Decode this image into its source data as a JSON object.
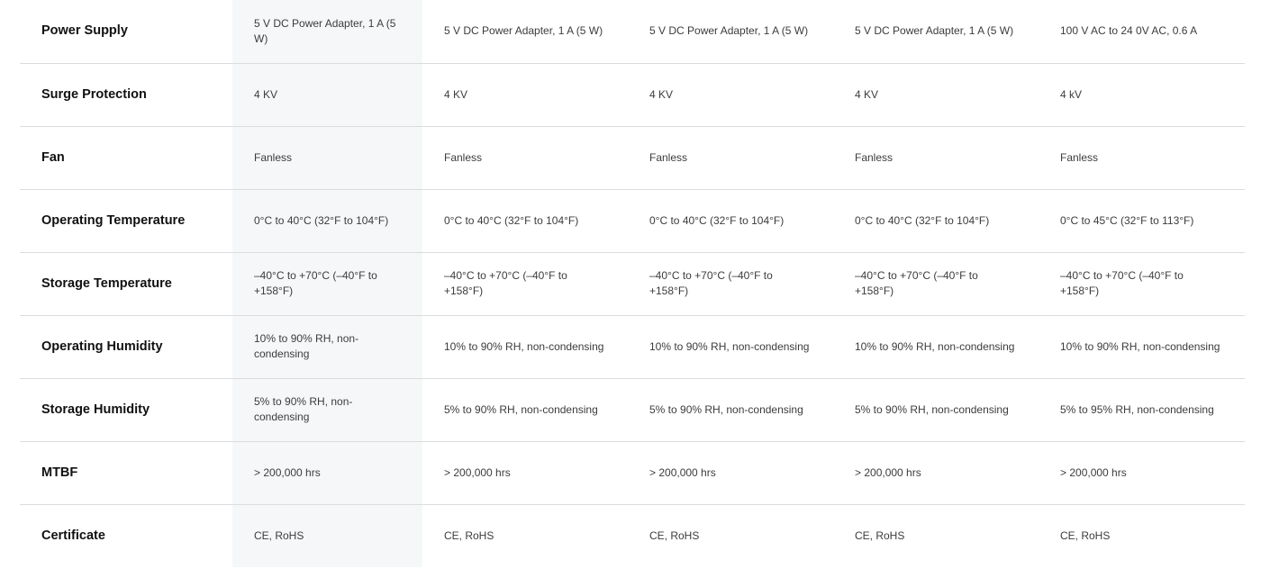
{
  "rows": [
    {
      "label": "Power Supply",
      "values": [
        "5 V DC Power Adapter, 1 A (5 W)",
        "5 V DC Power Adapter, 1 A (5 W)",
        "5 V DC Power Adapter, 1 A (5 W)",
        "5 V DC Power Adapter, 1 A (5 W)",
        "100 V AC to 24 0V AC, 0.6 A"
      ]
    },
    {
      "label": "Surge Protection",
      "values": [
        "4 KV",
        "4 KV",
        "4 KV",
        "4 KV",
        "4 kV"
      ]
    },
    {
      "label": "Fan",
      "values": [
        "Fanless",
        "Fanless",
        "Fanless",
        "Fanless",
        "Fanless"
      ]
    },
    {
      "label": "Operating Temperature",
      "values": [
        "0°C to 40°C (32°F to 104°F)",
        "0°C to 40°C (32°F to 104°F)",
        "0°C to 40°C (32°F to 104°F)",
        "0°C to 40°C (32°F to 104°F)",
        "0°C to 45°C (32°F to 113°F)"
      ]
    },
    {
      "label": "Storage Temperature",
      "values": [
        "–40°C to +70°C (–40°F to +158°F)",
        "–40°C to +70°C (–40°F to +158°F)",
        "–40°C to +70°C (–40°F to +158°F)",
        "–40°C to +70°C (–40°F to +158°F)",
        "–40°C to +70°C (–40°F to +158°F)"
      ]
    },
    {
      "label": "Operating Humidity",
      "values": [
        "10% to 90% RH, non-condensing",
        "10% to 90% RH, non-condensing",
        "10% to 90% RH, non-condensing",
        "10% to 90% RH, non-condensing",
        "10% to 90% RH, non-condensing"
      ]
    },
    {
      "label": "Storage Humidity",
      "values": [
        "5% to 90% RH, non-condensing",
        "5% to 90% RH, non-condensing",
        "5% to 90% RH, non-condensing",
        "5% to 90% RH, non-condensing",
        "5% to 95% RH, non-condensing"
      ]
    },
    {
      "label": "MTBF",
      "values": [
        "> 200,000 hrs",
        "> 200,000 hrs",
        "> 200,000 hrs",
        "> 200,000 hrs",
        "> 200,000 hrs"
      ]
    },
    {
      "label": "Certificate",
      "values": [
        "CE, RoHS",
        "CE, RoHS",
        "CE, RoHS",
        "CE, RoHS",
        "CE, RoHS"
      ]
    }
  ],
  "colors": {
    "highlight_column": "#f5f7f9",
    "divider": "#dcdcdc",
    "label_text": "#111111",
    "value_text": "#3c3c3c"
  }
}
